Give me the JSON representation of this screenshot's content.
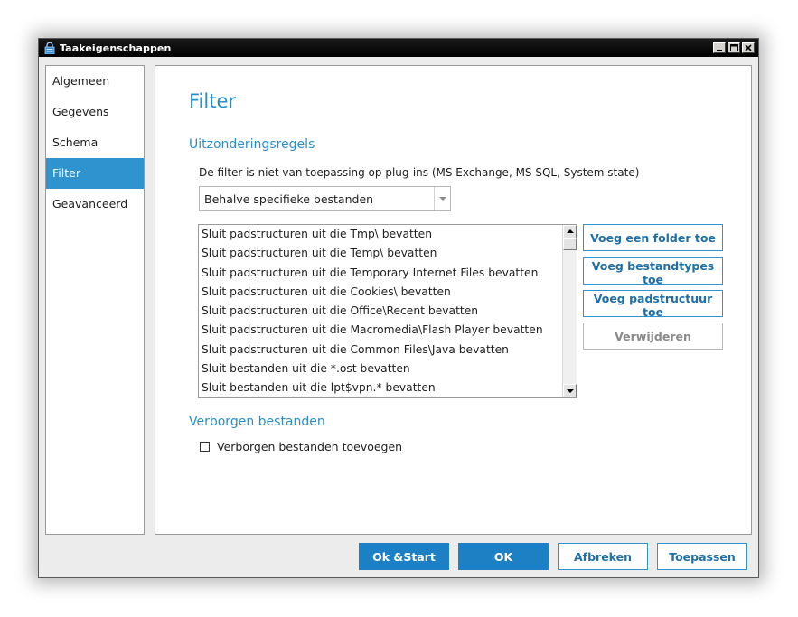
{
  "window": {
    "title": "Taakeigenschappen",
    "controls": [
      "minimize-icon",
      "maximize-icon",
      "close-icon"
    ]
  },
  "sidebar": {
    "items": [
      {
        "label": "Algemeen",
        "active": false
      },
      {
        "label": "Gegevens",
        "active": false
      },
      {
        "label": "Schema",
        "active": false
      },
      {
        "label": "Filter",
        "active": true
      },
      {
        "label": "Geavanceerd",
        "active": false
      }
    ]
  },
  "main": {
    "title": "Filter",
    "exceptions": {
      "heading": "Uitzonderingsregels",
      "note": "De filter is niet van toepassing op plug-ins  (MS Exchange, MS SQL, System state)",
      "dropdown_value": "Behalve specifieke bestanden",
      "rules": [
        "Sluit padstructuren uit die Tmp\\ bevatten",
        "Sluit padstructuren uit die Temp\\ bevatten",
        "Sluit padstructuren uit die Temporary Internet Files bevatten",
        "Sluit padstructuren uit die Cookies\\ bevatten",
        "Sluit padstructuren uit die Office\\Recent bevatten",
        "Sluit padstructuren uit die Macromedia\\Flash Player bevatten",
        "Sluit padstructuren uit die Common Files\\Java bevatten",
        "Sluit bestanden uit die *.ost bevatten",
        "Sluit bestanden uit die lpt$vpn.* bevatten"
      ],
      "buttons": {
        "add_folder": "Voeg een folder toe",
        "add_filetypes": "Voeg bestandtypes toe",
        "add_path": "Voeg padstructuur toe",
        "remove": "Verwijderen"
      }
    },
    "hidden": {
      "heading": "Verborgen bestanden",
      "checkbox_label": "Verborgen bestanden toevoegen",
      "checked": false
    }
  },
  "footer": {
    "ok_start": "Ok &Start",
    "ok": "OK",
    "cancel": "Afbreken",
    "apply": "Toepassen"
  },
  "colors": {
    "accent": "#2f93cf",
    "heading": "#2a8fc8",
    "primary_button": "#1d7fc4",
    "titlebar": "#000000"
  }
}
